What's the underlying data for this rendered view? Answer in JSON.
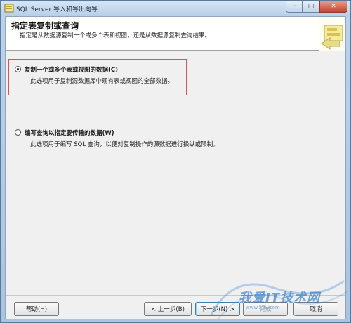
{
  "window": {
    "title": "SQL Server 导入和导出向导",
    "controls": {
      "minimize": "–",
      "maximize": "□",
      "close": "✕"
    }
  },
  "header": {
    "title": "指定表复制或查询",
    "subtitle": "指定是从数据源复制一个或多个表和视图，还是从数据源复制查询结果。"
  },
  "options": [
    {
      "label": "复制一个或多个表或视图的数据(C)",
      "description": "此选项用于复制源数据库中现有表或视图的全部数据。",
      "checked": true
    },
    {
      "label": "编写查询以指定要传输的数据(W)",
      "description": "此选项用于编写 SQL 查询，以便对复制操作的源数据进行操纵或限制。",
      "checked": false
    }
  ],
  "buttons": {
    "help": "帮助(H)",
    "back": "< 上一步(B)",
    "next": "下一步(N) >",
    "finish": "完成",
    "cancel": "取消"
  },
  "watermark": {
    "text": "我爱IT技术网",
    "sub": "www.52ij.com"
  },
  "colors": {
    "highlight": "#e05050",
    "titlebar": "#b7cfe7"
  },
  "icons": {
    "app": "app-icon",
    "header_art": "wizard-banner-icon"
  }
}
